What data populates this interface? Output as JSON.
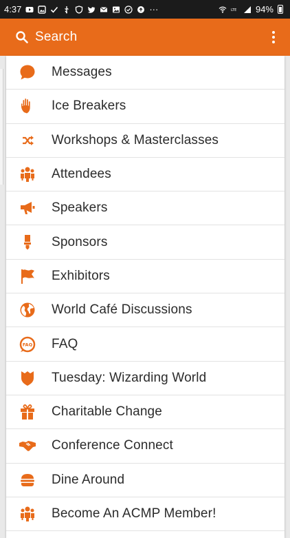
{
  "status_bar": {
    "time": "4:37",
    "more": "···",
    "battery_percent": "94%"
  },
  "app_bar": {
    "search_label": "Search",
    "background_color": "#e86b1a"
  },
  "accent_color": "#e86b1a",
  "menu": {
    "items": [
      {
        "label": "Messages",
        "icon": "chat-bubble-icon"
      },
      {
        "label": "Ice Breakers",
        "icon": "hand-icon"
      },
      {
        "label": "Workshops & Masterclasses",
        "icon": "shuffle-icon"
      },
      {
        "label": "Attendees",
        "icon": "people-icon"
      },
      {
        "label": "Speakers",
        "icon": "megaphone-icon"
      },
      {
        "label": "Sponsors",
        "icon": "medal-icon"
      },
      {
        "label": "Exhibitors",
        "icon": "flag-icon"
      },
      {
        "label": "World Café Discussions",
        "icon": "globe-icon"
      },
      {
        "label": "FAQ",
        "icon": "faq-bubble-icon"
      },
      {
        "label": "Tuesday: Wizarding World",
        "icon": "shield-icon"
      },
      {
        "label": "Charitable Change",
        "icon": "gift-icon"
      },
      {
        "label": "Conference Connect",
        "icon": "handshake-icon"
      },
      {
        "label": "Dine Around",
        "icon": "burger-icon"
      },
      {
        "label": "Become An ACMP Member!",
        "icon": "people-icon"
      }
    ]
  }
}
